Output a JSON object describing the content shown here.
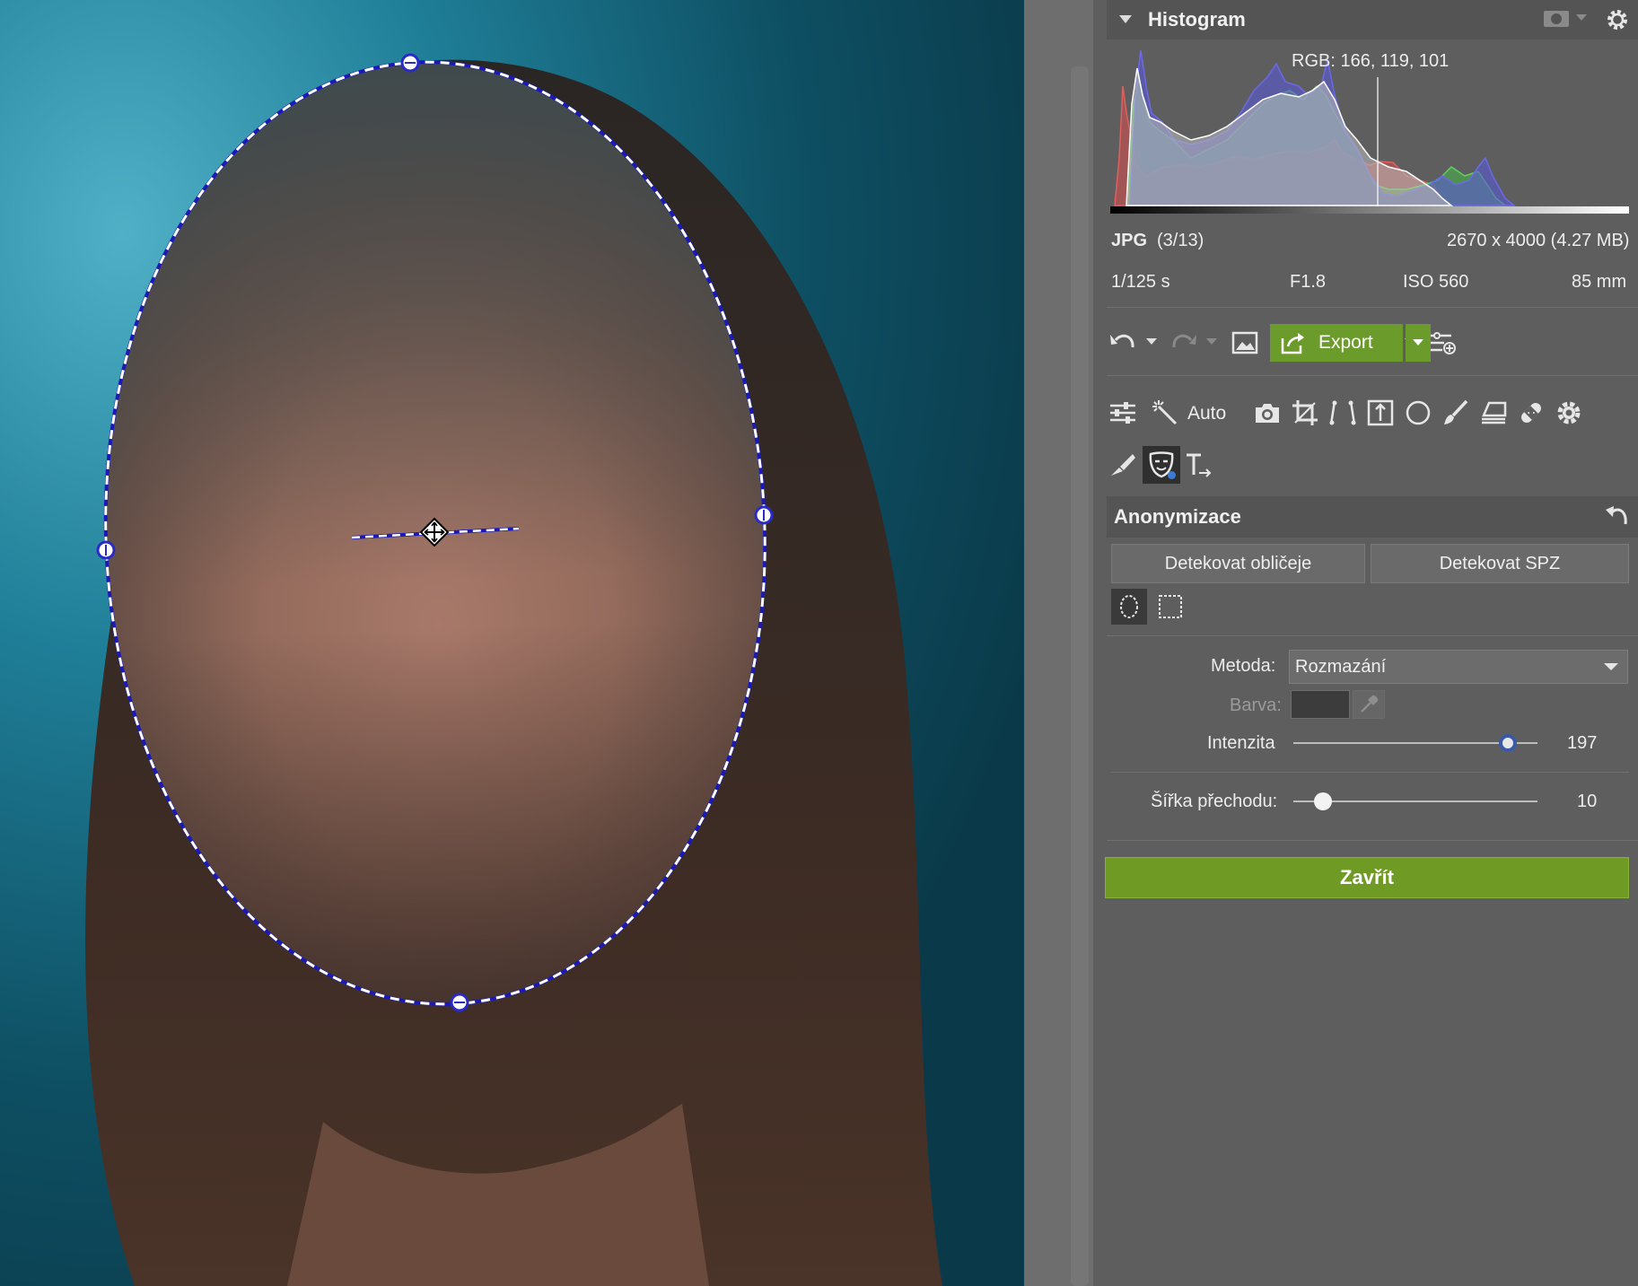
{
  "histogram": {
    "title": "Histogram",
    "rgb_readout": "RGB: 166, 119, 101",
    "colors": {
      "red": "#d94848",
      "green": "#4fc24f",
      "blue": "#5b5bd6"
    }
  },
  "file_info": {
    "format": "JPG",
    "index": "(3/13)",
    "dimensions": "2670 x 4000 (4.27 MB)",
    "shutter": "1/125 s",
    "aperture": "F1.8",
    "iso": "ISO 560",
    "focal_length": "85 mm"
  },
  "toolbar": {
    "export_label": "Export",
    "auto_label": "Auto",
    "accent": "#6b9b2a"
  },
  "anonymization": {
    "title": "Anonymizace",
    "detect_faces_label": "Detekovat obličeje",
    "detect_plates_label": "Detekovat SPZ",
    "method_label": "Metoda:",
    "method_value": "Rozmazání",
    "color_label": "Barva:",
    "intensity_label": "Intenzita",
    "intensity_value": "197",
    "intensity_fraction": 0.88,
    "feather_label": "Šířka přechodu:",
    "feather_value": "10",
    "feather_fraction": 0.12,
    "close_label": "Zavřít"
  }
}
